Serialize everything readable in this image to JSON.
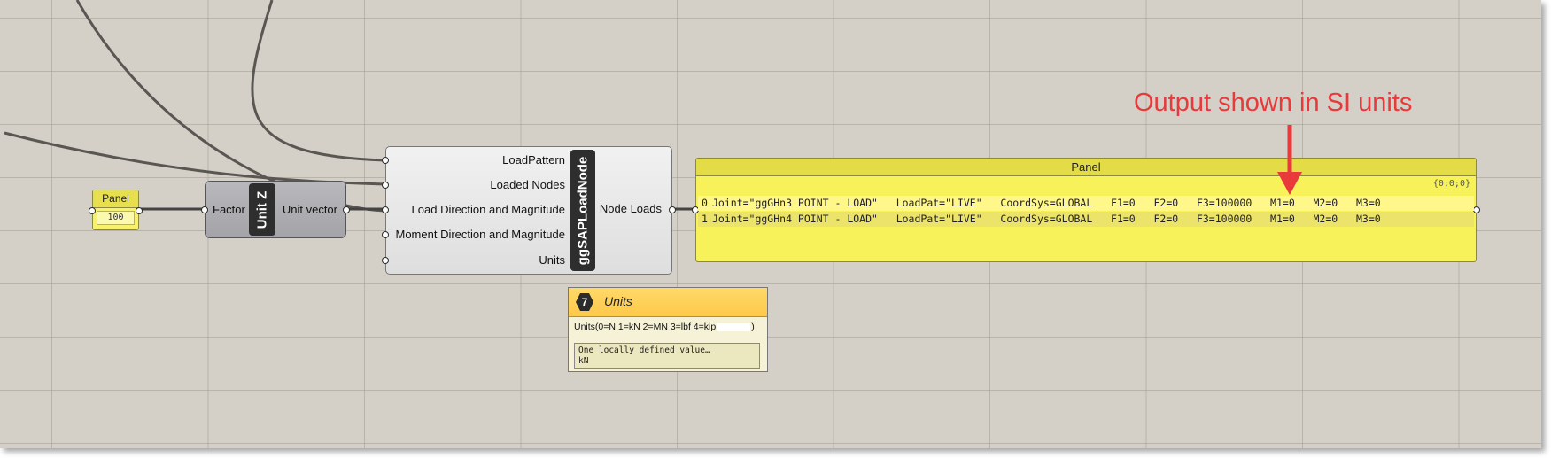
{
  "panel_small": {
    "title": "Panel",
    "value": "100"
  },
  "unit_z": {
    "input": "Factor",
    "nickname": "Unit Z",
    "output": "Unit vector"
  },
  "load_node": {
    "inputs": [
      "LoadPattern",
      "Loaded Nodes",
      "Load Direction and Magnitude",
      "Moment Direction and Magnitude",
      "Units"
    ],
    "nickname": "ggSAPLoadNode",
    "output": "Node Loads"
  },
  "panel_big": {
    "title": "Panel",
    "path": "{0;0;0}",
    "rows": [
      {
        "index": "0",
        "text": "Joint=\"ggGHn3 POINT - LOAD\"   LoadPat=\"LIVE\"   CoordSys=GLOBAL   F1=0   F2=0   F3=100000   M1=0   M2=0   M3=0"
      },
      {
        "index": "1",
        "text": "Joint=\"ggGHn4 POINT - LOAD\"   LoadPat=\"LIVE\"   CoordSys=GLOBAL   F1=0   F2=0   F3=100000   M1=0   M2=0   M3=0"
      }
    ]
  },
  "annotation": {
    "text": "Output shown in SI units",
    "color": "#e8393b"
  },
  "tooltip": {
    "badge": "7",
    "title": "Units",
    "description": "Units(0=N 1=kN 2=MN 3=lbf 4=kip",
    "description_end": ")",
    "value_line1": "One locally defined value…",
    "value_line2": "kN"
  },
  "colors": {
    "canvas": "#d4d0c8",
    "panel_yellow": "#f7f25a",
    "component_grey": "#b9b9bd",
    "tooltip_header": "#ffd968"
  }
}
